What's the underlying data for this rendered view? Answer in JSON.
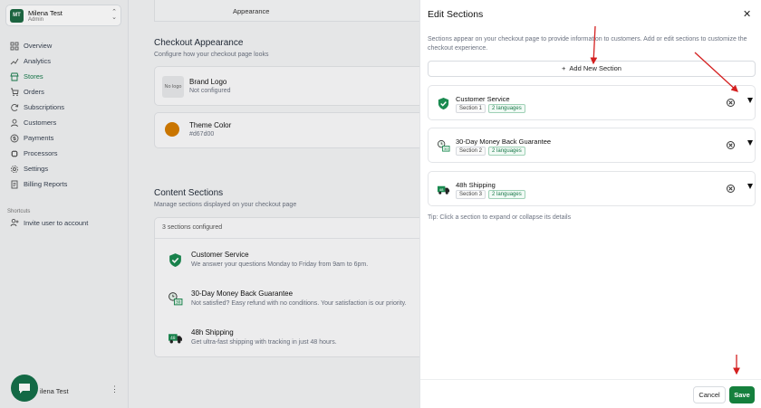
{
  "account": {
    "initials": "MT",
    "name": "Milena Test",
    "role": "Admin"
  },
  "nav": [
    {
      "label": "Overview",
      "icon": "grid-icon"
    },
    {
      "label": "Analytics",
      "icon": "chart-icon"
    },
    {
      "label": "Stores",
      "icon": "store-icon",
      "active": true
    },
    {
      "label": "Orders",
      "icon": "cart-icon"
    },
    {
      "label": "Subscriptions",
      "icon": "refresh-icon"
    },
    {
      "label": "Customers",
      "icon": "user-icon"
    },
    {
      "label": "Payments",
      "icon": "dollar-icon"
    },
    {
      "label": "Processors",
      "icon": "processor-icon"
    },
    {
      "label": "Settings",
      "icon": "gear-icon"
    },
    {
      "label": "Billing Reports",
      "icon": "report-icon"
    }
  ],
  "shortcuts": {
    "heading": "Shortcuts",
    "invite": "Invite user to account"
  },
  "bottom_user": "ilena Test",
  "main": {
    "tab": "Appearance",
    "checkout": {
      "title": "Checkout Appearance",
      "subtitle": "Configure how your checkout page looks",
      "logo": {
        "placeholder": "No logo",
        "title": "Brand Logo",
        "status": "Not configured"
      },
      "theme": {
        "title": "Theme Color",
        "value": "#d67d00"
      }
    },
    "content": {
      "title": "Content Sections",
      "subtitle": "Manage sections displayed on your checkout page",
      "count": "3 sections configured",
      "sections": [
        {
          "title": "Customer Service",
          "desc": "We answer your questions Monday to Friday from 9am to 6pm.",
          "icon": "shield-check-icon"
        },
        {
          "title": "30-Day Money Back Guarantee",
          "desc": "Not satisfied? Easy refund with no conditions. Your satisfaction is our priority.",
          "icon": "calendar-money-icon"
        },
        {
          "title": "48h Shipping",
          "desc": "Get ultra-fast shipping with tracking in just 48 hours.",
          "icon": "truck-icon"
        }
      ]
    }
  },
  "drawer": {
    "title": "Edit Sections",
    "description": "Sections appear on your checkout page to provide information to customers. Add or edit sections to customize the checkout experience.",
    "add_label": "Add New Section",
    "sections": [
      {
        "title": "Customer Service",
        "tag": "Section 1",
        "langs": "2 languages",
        "icon": "shield-check-icon"
      },
      {
        "title": "30-Day Money Back Guarantee",
        "tag": "Section 2",
        "langs": "2 languages",
        "icon": "calendar-money-icon"
      },
      {
        "title": "48h Shipping",
        "tag": "Section 3",
        "langs": "2 languages",
        "icon": "truck-icon"
      }
    ],
    "tip": "Tip: Click a section to expand or collapse its details",
    "cancel_label": "Cancel",
    "save_label": "Save"
  },
  "colors": {
    "brand_green": "#15803d",
    "theme_color": "#d67d00",
    "annotation_red": "#d42020"
  }
}
